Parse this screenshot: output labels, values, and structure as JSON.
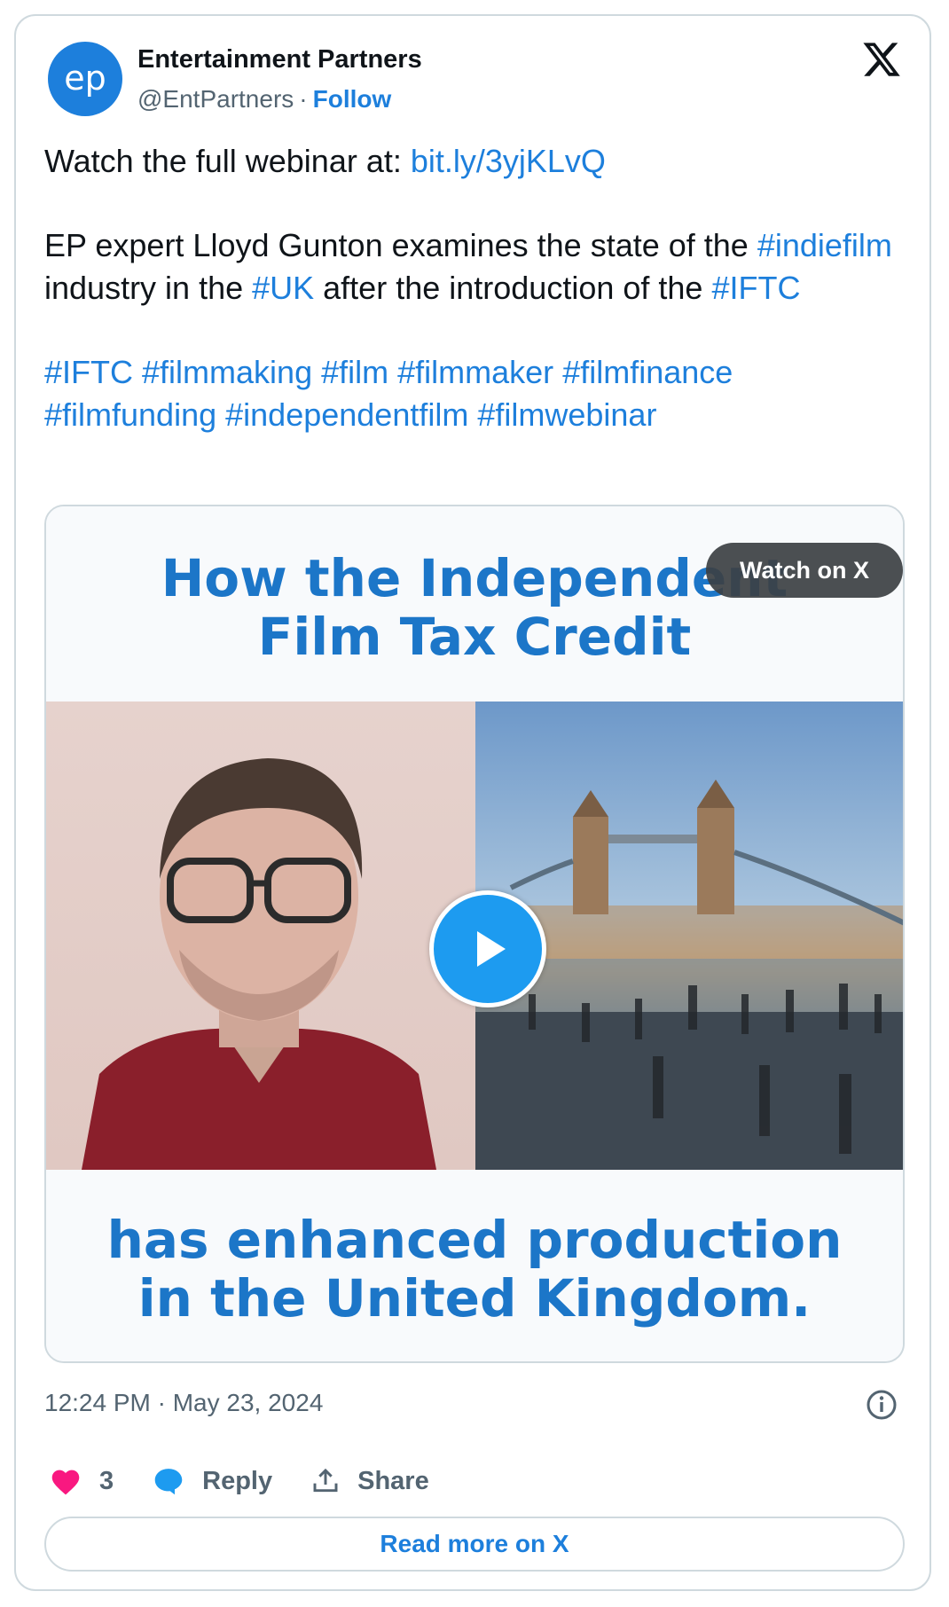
{
  "author": {
    "name": "Entertainment Partners",
    "handle": "@EntPartners",
    "separator": "·",
    "follow_label": "Follow",
    "avatar_text": "ep"
  },
  "tweet": {
    "line1_prefix": "Watch the full webinar at: ",
    "line1_link": "bit.ly/3yjKLvQ",
    "p2_a": "EP expert Lloyd Gunton examines the state of the ",
    "p2_tag1": "#indiefilm",
    "p2_b": " industry in the ",
    "p2_tag2": "#UK",
    "p2_c": " after the introduction of the ",
    "p2_tag3": "#IFTC",
    "hashtags": [
      "#IFTC",
      "#filmmaking",
      "#film",
      "#filmmaker",
      "#filmfinance",
      "#filmfunding",
      "#independentfilm",
      "#filmwebinar"
    ]
  },
  "media": {
    "headline_top_1": "How the Independent",
    "headline_top_2": "Film Tax Credit",
    "headline_bottom_1": "has enhanced production",
    "headline_bottom_2": "in the United Kingdom.",
    "watch_label": "Watch on X"
  },
  "meta": {
    "timestamp": "12:24 PM · May 23, 2024"
  },
  "actions": {
    "likes": "3",
    "reply_label": "Reply",
    "share_label": "Share",
    "read_more_label": "Read more on X"
  },
  "colors": {
    "link": "#1d7fdc",
    "brand": "#1d7fdc",
    "heart": "#f91880",
    "reply_bubble": "#1d9bf0",
    "headline": "#1c76c8"
  }
}
